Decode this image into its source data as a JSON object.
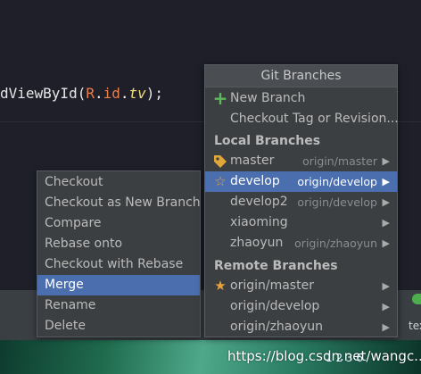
{
  "editor": {
    "code_prefix": "dViewById(",
    "code_class": "R",
    "code_dot1": ".",
    "code_id": "id",
    "code_dot2": ".",
    "code_field": "tv",
    "code_suffix": ");"
  },
  "context_menu": {
    "items": [
      {
        "label": "Checkout"
      },
      {
        "label": "Checkout as New Branch"
      },
      {
        "label": "Compare"
      },
      {
        "label": "Rebase onto"
      },
      {
        "label": "Checkout with Rebase"
      },
      {
        "label": "Merge",
        "selected": true
      },
      {
        "label": "Rename"
      },
      {
        "label": "Delete"
      }
    ]
  },
  "git_branches": {
    "title": "Git Branches",
    "actions": [
      {
        "label": "New Branch",
        "icon": "plus-icon"
      },
      {
        "label": "Checkout Tag or Revision..."
      }
    ],
    "local_header": "Local Branches",
    "local": [
      {
        "name": "master",
        "tracking": "origin/master",
        "icon": "tag-icon"
      },
      {
        "name": "develop",
        "tracking": "origin/develop",
        "icon": "star-outline-icon",
        "selected": true
      },
      {
        "name": "develop2",
        "tracking": "origin/develop"
      },
      {
        "name": "xiaoming",
        "tracking": ""
      },
      {
        "name": "zhaoyun",
        "tracking": "origin/zhaoyun"
      }
    ],
    "remote_header": "Remote Branches",
    "remote": [
      {
        "name": "origin/master",
        "icon": "star-filled-icon"
      },
      {
        "name": "origin/develop"
      },
      {
        "name": "origin/zhaoyun"
      }
    ],
    "submenu_arrow": "▶"
  },
  "status": {
    "partial_text": "text"
  },
  "watermark": "https://blog.csdn.net/wangc...",
  "tray_text": "1 2 3 6",
  "colors": {
    "selection": "#4b6eaf",
    "plus_icon": "#5fb85f",
    "tag_icon": "#e0a63a",
    "star_icon": "#e8a33d"
  }
}
